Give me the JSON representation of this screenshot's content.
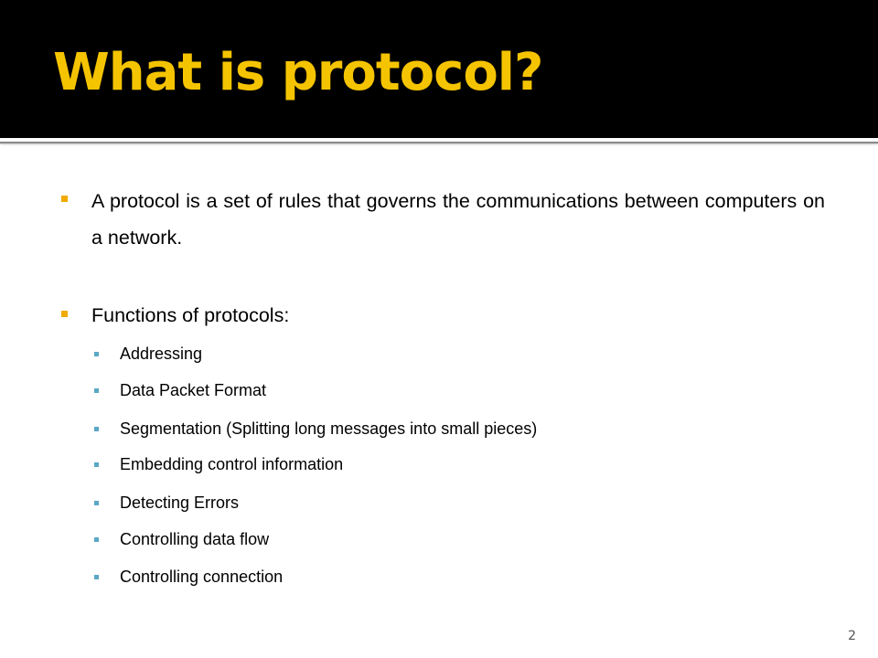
{
  "slide": {
    "title": "What is protocol?",
    "title_color": "#F5C400",
    "header_background": "#000000",
    "number": "2"
  },
  "body": {
    "bullets": [
      {
        "text": "A protocol is a set of rules that governs the communications between computers on a network.",
        "bullet_icon": "square-bullet-orange",
        "bullet_color": "#F0AA00"
      },
      {
        "text": "Functions of protocols:",
        "bullet_icon": "square-bullet-orange",
        "bullet_color": "#F0AA00",
        "sub_items": [
          "Addressing",
          "Data Packet Format",
          "Segmentation (Splitting long messages into small pieces)",
          "Embedding control information",
          "Detecting Errors",
          "Controlling data flow",
          "Controlling connection"
        ],
        "sub_bullet_icon": "square-bullet-blue",
        "sub_bullet_color": "#5BA7C6"
      }
    ]
  }
}
